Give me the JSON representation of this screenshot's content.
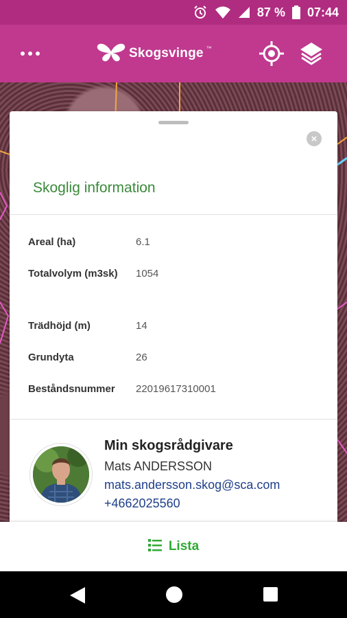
{
  "status_bar": {
    "battery_percent": "87 %",
    "time": "07:44",
    "icons": [
      "alarm-icon",
      "wifi-icon",
      "signal-icon",
      "battery-icon"
    ]
  },
  "app_bar": {
    "brand_name": "Skogsvinge",
    "brand_tm": "™",
    "icons": [
      "more-icon",
      "butterfly-logo-icon",
      "locate-icon",
      "layers-icon"
    ]
  },
  "sheet": {
    "close_glyph": "×",
    "section_title": "Skoglig information",
    "rows": [
      {
        "label": "Areal (ha)",
        "value": "6.1"
      },
      {
        "label": "Totalvolym (m3sk)",
        "value": "1054"
      },
      {
        "label": "Trädhöjd (m)",
        "value": "14"
      },
      {
        "label": "Grundyta",
        "value": "26"
      },
      {
        "label": "Beståndsnummer",
        "value": "22019617310001"
      }
    ],
    "advisor": {
      "heading": "Min skogsrådgivare",
      "name": "Mats ANDERSSON",
      "email": "mats.andersson.skog@sca.com",
      "phone": "+4662025560"
    }
  },
  "bottom_bar": {
    "list_label": "Lista",
    "icon": "list-icon"
  },
  "nav_bar": {
    "icons": [
      "back-icon",
      "home-icon",
      "recents-icon"
    ]
  },
  "colors": {
    "app_bar": "#c0398f",
    "status_bar": "#b02c80",
    "section_title": "#3a8a3a",
    "list_green": "#2faa34",
    "link_blue": "#1f3f8a"
  }
}
